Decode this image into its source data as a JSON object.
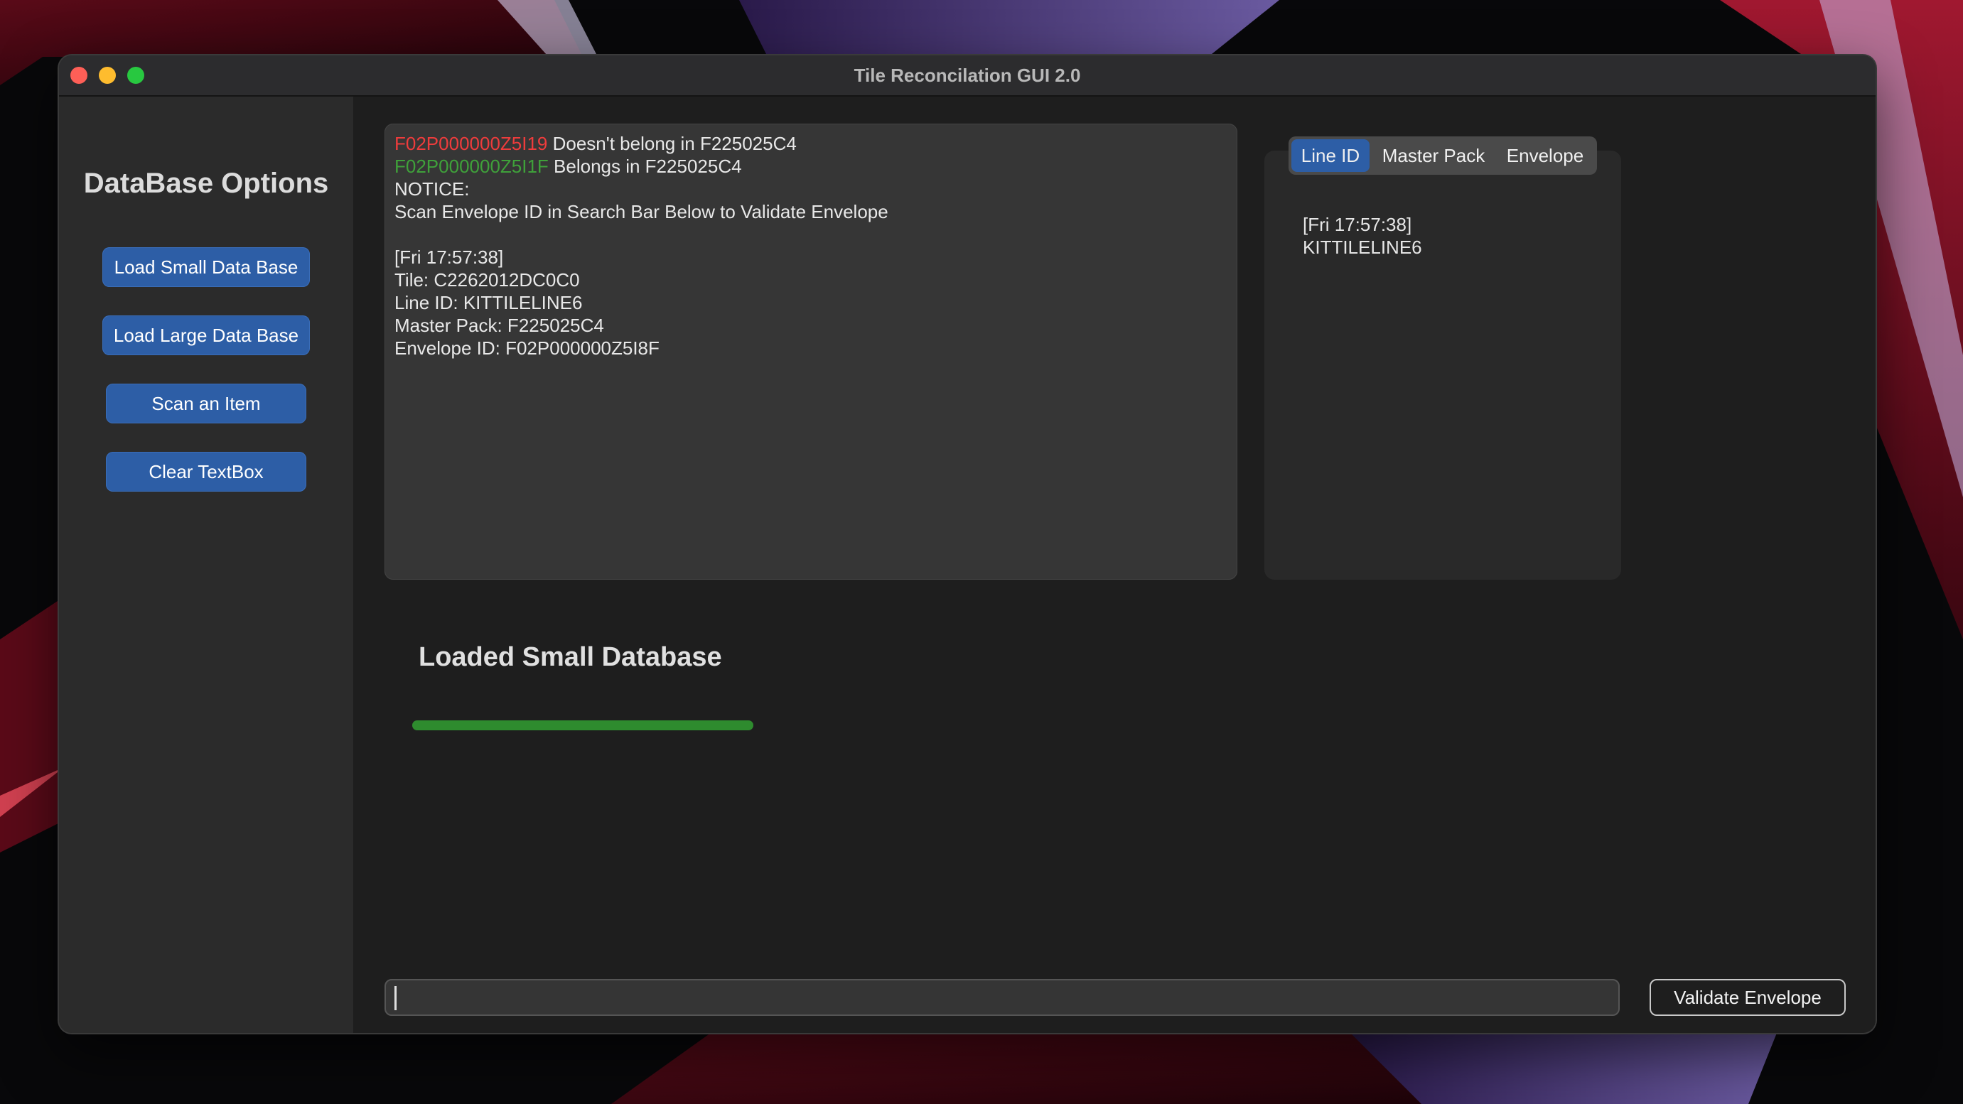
{
  "window": {
    "title": "Tile Reconcilation GUI 2.0"
  },
  "sidebar": {
    "heading": "DataBase Options",
    "buttons": [
      {
        "label": "Load Small Data Base"
      },
      {
        "label": "Load Large Data Base"
      },
      {
        "label": "Scan an Item"
      },
      {
        "label": "Clear TextBox"
      }
    ]
  },
  "output": {
    "line1_id": "F02P000000Z5I19",
    "line1_text": " Doesn't belong in F225025C4",
    "line2_id": "F02P000000Z5I1F",
    "line2_text": " Belongs in F225025C4",
    "notice": "NOTICE:",
    "instruction": "Scan Envelope ID in Search Bar Below to Validate Envelope",
    "timestamp": "[Fri 17:57:38]",
    "tile": "Tile: C2262012DC0C0",
    "line_id": "Line ID: KITTILELINE6",
    "master_pack": "Master Pack: F225025C4",
    "envelope_id": "Envelope ID: F02P000000Z5I8F"
  },
  "tabs": {
    "items": [
      {
        "label": "Line ID"
      },
      {
        "label": "Master Pack"
      },
      {
        "label": "Envelope"
      }
    ],
    "active_index": 0,
    "content_timestamp": "[Fri 17:57:38]",
    "content_value": "KITTILELINE6"
  },
  "status": {
    "label": "Loaded Small Database",
    "progress": 1.0
  },
  "search": {
    "value": "",
    "placeholder": ""
  },
  "validate_button": {
    "label": "Validate Envelope"
  },
  "colors": {
    "accent_blue": "#2d5ea6",
    "progress_green": "#2e8b2e",
    "error_red": "#ee3c3c",
    "success_green": "#3fa13a"
  }
}
